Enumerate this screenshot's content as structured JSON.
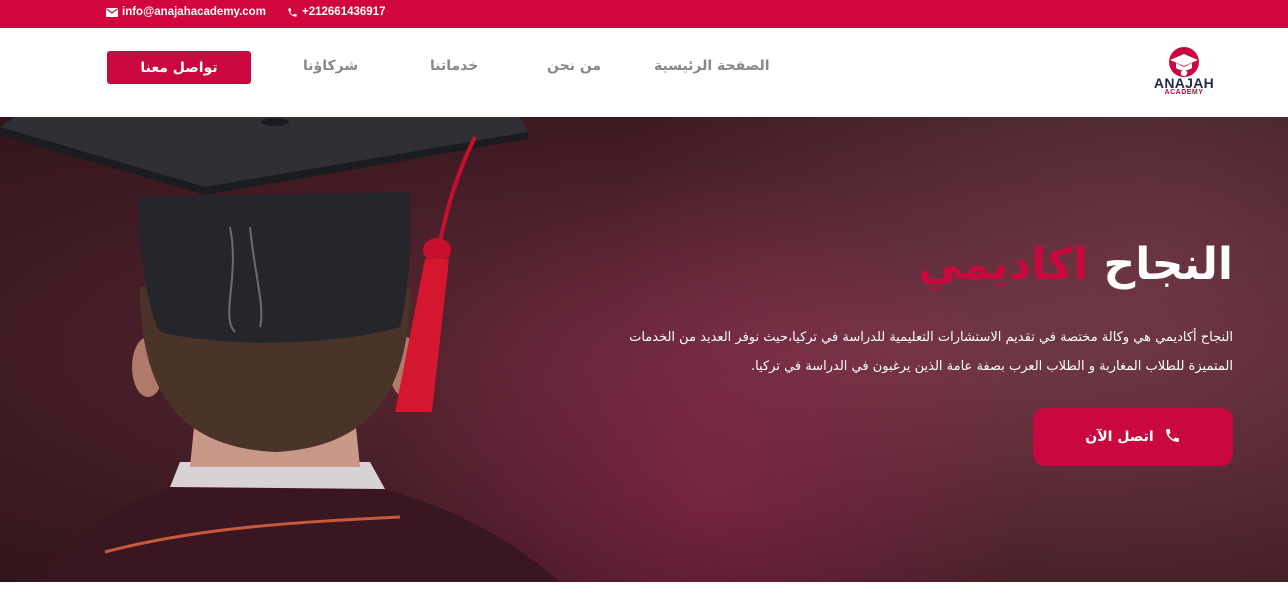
{
  "topbar": {
    "email": "info@anajahacademy.com",
    "phone": "+212661436917",
    "background": "#d0063d"
  },
  "navbar": {
    "cta_label": "تواصل معنا",
    "items": [
      {
        "label": "الصفحة الرئيسية"
      },
      {
        "label": "من نحن"
      },
      {
        "label": "خدماتنا"
      },
      {
        "label": "شركاؤنا"
      }
    ]
  },
  "logo": {
    "name": "ANAJAH",
    "sub": "ACADEMY"
  },
  "hero": {
    "title_word1": "النجاح",
    "title_word2": "اكاديمي",
    "description": "النجاح أكاديمي هي وكالة مختصة في تقديم الاستشارات التعليمية للدراسة في تركيا،حيث نوفر العديد من الخدمات المتميزة للطلاب المغاربة و الطلاب العرب بصفة عامة الذين يرغبون في الدراسة في تركيا.",
    "call_label": "اتصل الآن",
    "call_icon": "phone-icon"
  },
  "colors": {
    "accent": "#c8083f",
    "nav_text": "#888888",
    "logo_text": "#1f2b4a"
  }
}
